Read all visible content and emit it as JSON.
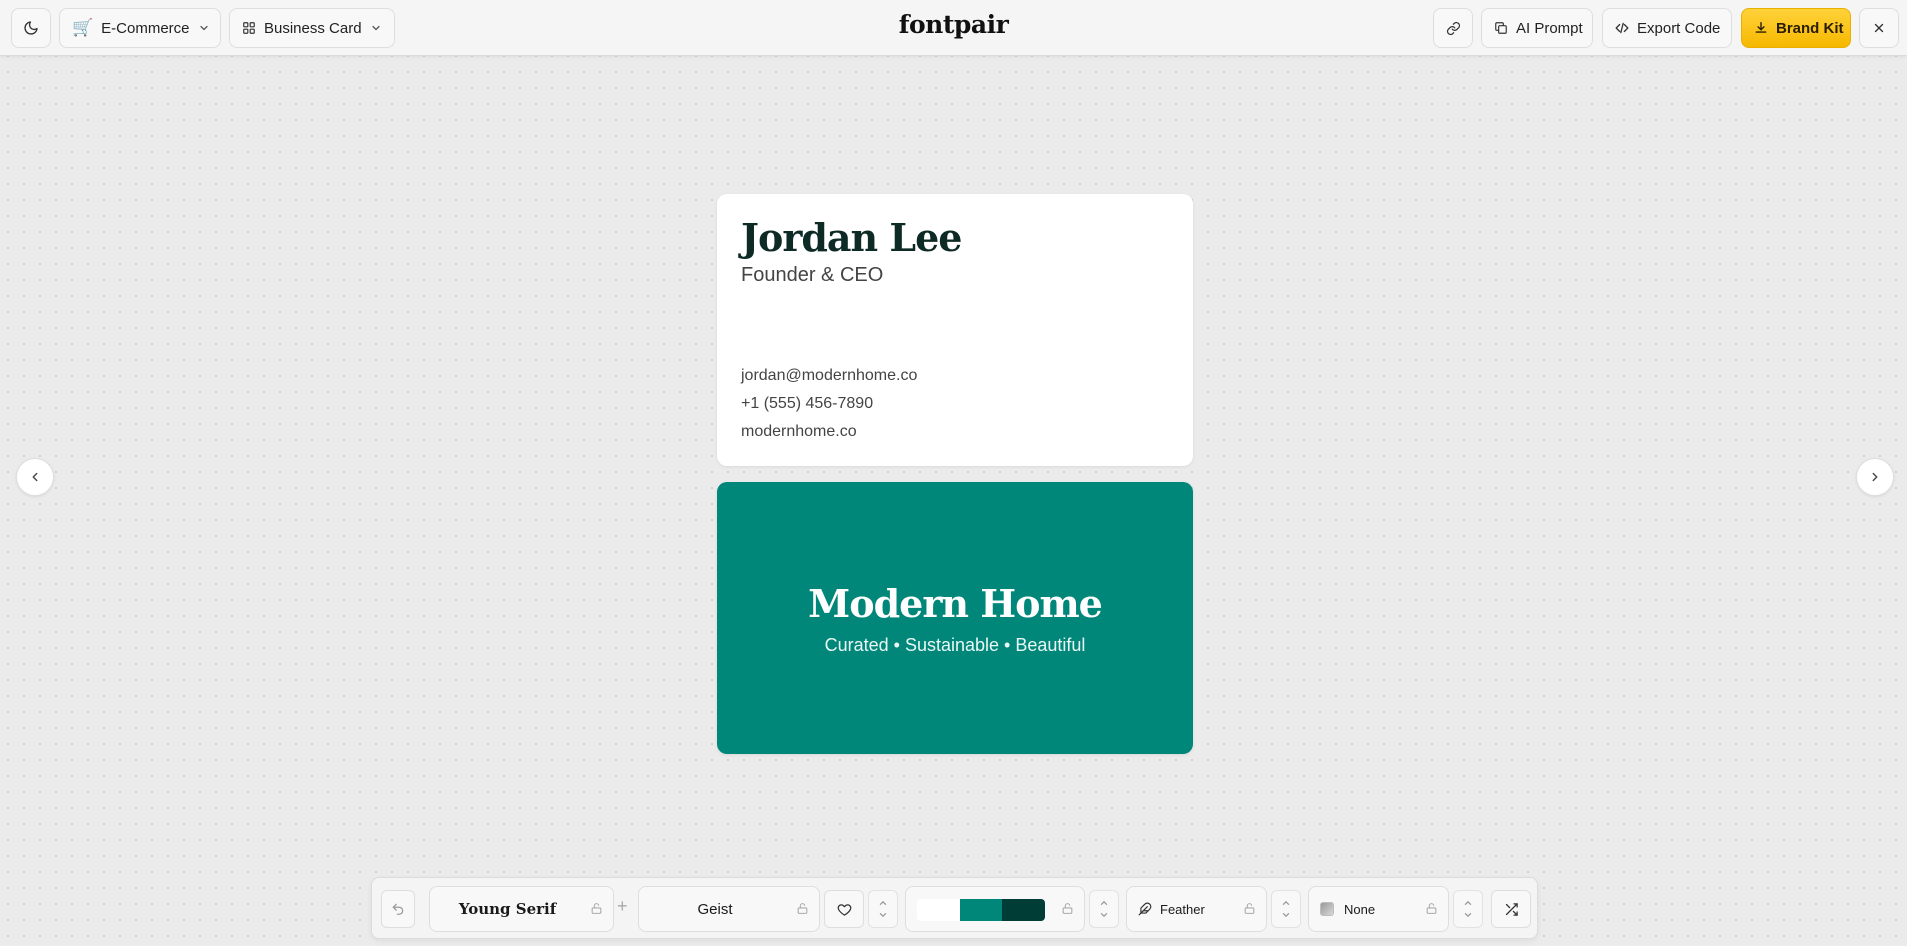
{
  "topbar": {
    "category": "E-Commerce",
    "template": "Business Card",
    "logo": "fontpair",
    "ai_prompt_label": "AI Prompt",
    "export_code_label": "Export Code",
    "brand_kit_label": "Brand Kit"
  },
  "card_front": {
    "name": "Jordan Lee",
    "title": "Founder & CEO",
    "email": "jordan@modernhome.co",
    "phone": "+1 (555) 456-7890",
    "website": "modernhome.co"
  },
  "card_back": {
    "company": "Modern Home",
    "tagline": "Curated • Sustainable • Beautiful"
  },
  "toolbar": {
    "heading_font": "Young Serif",
    "body_font": "Geist",
    "palette": [
      "#ffffff",
      "#00877a",
      "#003d36"
    ],
    "icon_style": "Feather",
    "effect": "None"
  },
  "colors": {
    "accent": "#00877a",
    "accent_dark": "#003d36",
    "brand_button": "#ffc61a"
  },
  "icons": [
    "moon-icon",
    "cart-icon",
    "grid-icon",
    "chevron-down-icon",
    "link-icon",
    "copy-icon",
    "code-icon",
    "download-icon",
    "close-icon",
    "chevron-left-icon",
    "chevron-right-icon",
    "undo-icon",
    "lock-icon",
    "plus-icon",
    "heart-icon",
    "feather-icon",
    "shuffle-icon"
  ]
}
